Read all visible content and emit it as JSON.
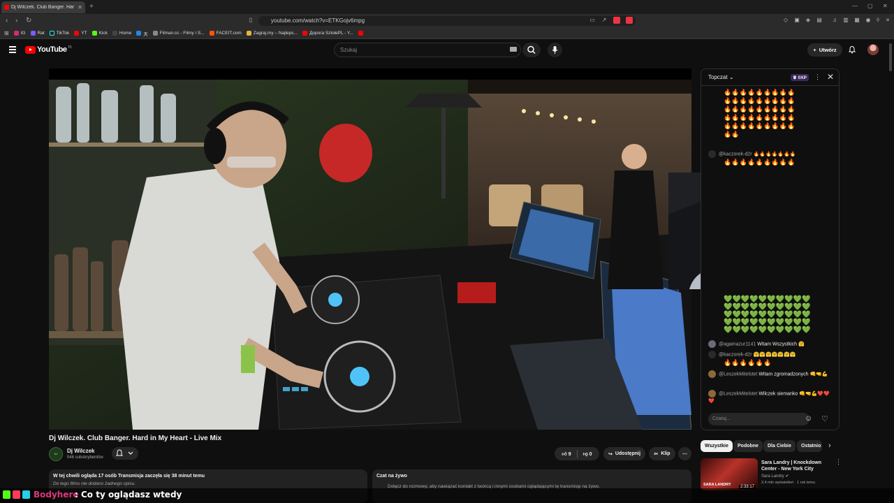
{
  "browser": {
    "tab_title": "Dj Wilczek. Club Banger. Har",
    "url": "youtube.com/watch?v=ETKGojv6mpg",
    "bookmarks": [
      {
        "label": "IG",
        "color": "#d62976"
      },
      {
        "label": "Rat",
        "color": "#7b5cff"
      },
      {
        "label": "TikTok",
        "color": "#222222"
      },
      {
        "label": "YT",
        "color": "#ff0000"
      },
      {
        "label": "Kick",
        "color": "#53fc18"
      },
      {
        "label": "Home",
        "color": "#444444"
      },
      {
        "label": "天",
        "color": "#1e88e5"
      },
      {
        "label": "Filman.cc - Filmy i S...",
        "color": "#888888"
      },
      {
        "label": "FACEIT.com",
        "color": "#ff5500"
      },
      {
        "label": "Zagraj.my – Najleps...",
        "color": "#e2b53a"
      },
      {
        "label": "Дорога SzlolePL - Y...",
        "color": "#ff0000"
      },
      {
        "label": "",
        "color": "#ff0000"
      }
    ]
  },
  "youtube": {
    "logo_text": "YouTube",
    "country": "PL",
    "search_placeholder": "Szukaj",
    "create_label": "Utwórz"
  },
  "video": {
    "title": "Dj Wilczek. Club Banger. Hard in My Heart - Live Mix",
    "channel_name": "Dj Wilczek",
    "channel_subs": "546 subskrybentów",
    "likes": "9",
    "dislikes": "0",
    "share_label": "Udostępnij",
    "clip_label": "Klip",
    "description_line1": "W tej chwili ogląda 17 osób  Transmisja zaczęła się 38 minut temu",
    "description_line2": "Do tego filmu nie dodano żadnego opisu.",
    "replay_title": "Czat na żywo",
    "replay_text": "Dołącz do rozmowy, aby nawiązać kontakt z twórcą i innymi osobami oglądającymi tę transmisję na żywo."
  },
  "chat": {
    "mode_label": "Topczat",
    "xp_label": "0XP",
    "input_placeholder": "Czatuj...",
    "fire_row": "🔥🔥🔥🔥🔥🔥🔥🔥🔥",
    "messages": [
      {
        "author": "@kaczorek-d2r",
        "text": "🔥🔥🔥🔥🔥🔥🔥"
      },
      {
        "author": "@agamazur1141",
        "text": "Witam Wszystkich 🤗"
      },
      {
        "author": "@kaczorek-d2r",
        "text": "🤗🤗🤗🤗🤗🤗🤗"
      },
      {
        "author": "@LeszekMitelstet",
        "text": "Witam zgromadzonych 👊🤜💪"
      },
      {
        "author": "@LeszekMitelstet",
        "text": "Wilczek siemanko 👊🤜💪❤️❤️❤️"
      }
    ],
    "hearts_row": "💚💚💚💚💚💚💚💚💚💚"
  },
  "related": {
    "chips": [
      "Wszystkie",
      "Podobne",
      "Dla Ciebie",
      "Ostatnio"
    ],
    "item": {
      "title": "Sara Landry | Knockdown Center - New York City",
      "channel": "Sara Landry",
      "meta": "2,4 mln wyświetleń · 1 rok temu",
      "duration": "2:33:17",
      "thumb_text": "SARA LANDRY"
    }
  },
  "overlay": {
    "username": "Bodyhere",
    "message": ": Co ty oglądasz wtedy"
  },
  "colors": {
    "accent_red": "#ff0000",
    "background": "#0f0f0f",
    "overlay_name": "#e0357c"
  }
}
